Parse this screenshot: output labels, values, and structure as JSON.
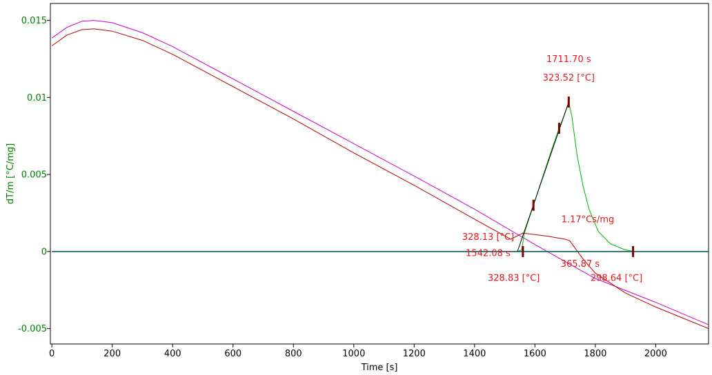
{
  "chart_data": {
    "type": "line",
    "xlabel": "Time [s]",
    "ylabel": "dT/m  [°C/mg]",
    "xlim": [
      -5,
      2175
    ],
    "ylim": [
      -0.006,
      0.0161
    ],
    "x_ticks": [
      0,
      200,
      400,
      600,
      800,
      1000,
      1200,
      1400,
      1600,
      1800,
      2000
    ],
    "y_ticks": [
      -0.005,
      0,
      0.005,
      0.01,
      0.015
    ],
    "y_tick_labels": [
      "-0.005",
      "0",
      "0.005",
      "0.01",
      "0.015"
    ],
    "grid": false,
    "colors": {
      "axis_text": "#008000",
      "annotation": "#e8141c",
      "magenta": "#cc00cc",
      "dark_red": "#b30000",
      "green": "#00b000",
      "baseline": "#0b5c5c",
      "tangent": "#000000",
      "marker": "#7a0000"
    },
    "series": [
      {
        "color": "magenta",
        "x": [
          0,
          50,
          100,
          140,
          200,
          300,
          400,
          600,
          800,
          1000,
          1200,
          1400,
          1600,
          1800,
          2000,
          2175
        ],
        "y": [
          0.01385,
          0.01455,
          0.01495,
          0.015,
          0.01485,
          0.0142,
          0.0133,
          0.0112,
          0.0091,
          0.007,
          0.0049,
          0.00275,
          0.00045,
          -0.00175,
          -0.0033,
          -0.00475
        ]
      },
      {
        "color": "dark_red",
        "x": [
          0,
          50,
          100,
          140,
          200,
          300,
          400,
          600,
          800,
          1000,
          1200,
          1400,
          1520,
          1560,
          1640,
          1700,
          1715,
          1760,
          1800,
          1900,
          2000,
          2175
        ],
        "y": [
          0.01335,
          0.01405,
          0.0144,
          0.01445,
          0.0143,
          0.0137,
          0.0128,
          0.0107,
          0.0086,
          0.0064,
          0.0043,
          0.0021,
          0.0008,
          0.0012,
          0.001,
          0.0008,
          0.0007,
          -0.0005,
          -0.0014,
          -0.0027,
          -0.0036,
          -0.005
        ]
      },
      {
        "color": "green",
        "x": [
          1542,
          1556,
          1565,
          1575,
          1595,
          1620,
          1650,
          1680,
          1700,
          1711.7,
          1722,
          1740,
          1760,
          1780,
          1810,
          1850,
          1900,
          1930
        ],
        "y": [
          0,
          0.0001,
          0.0012,
          0.0018,
          0.003,
          0.0045,
          0.0063,
          0.008,
          0.009,
          0.0097,
          0.0088,
          0.0062,
          0.0042,
          0.0027,
          0.0013,
          0.0005,
          0.0001,
          0
        ]
      },
      {
        "color": "baseline",
        "x": [
          0,
          2175
        ],
        "y": [
          0,
          0
        ]
      },
      {
        "color": "tangent",
        "x": [
          1542,
          1711.7
        ],
        "y": [
          0,
          0.0097
        ]
      }
    ],
    "markers": [
      {
        "x": 1560,
        "y": 0
      },
      {
        "x": 1595,
        "y": 0.003
      },
      {
        "x": 1680,
        "y": 0.008
      },
      {
        "x": 1711.7,
        "y": 0.0097
      },
      {
        "x": 1925,
        "y": 0
      }
    ],
    "annotations": [
      {
        "text": "1711.70 s",
        "x": 1711.7,
        "y": 0.0123
      },
      {
        "text": "323.52 [°C]",
        "x": 1711.7,
        "y": 0.0111
      },
      {
        "text": "1.17°Cs/mg",
        "x": 1775,
        "y": 0.0019
      },
      {
        "text": "328.13 [°C]",
        "x": 1445,
        "y": 0.00075
      },
      {
        "text": "1542.08 s",
        "x": 1445,
        "y": -0.0003
      },
      {
        "text": "328.83 [°C]",
        "x": 1530,
        "y": -0.0019
      },
      {
        "text": "365.87 s",
        "x": 1750,
        "y": -0.001
      },
      {
        "text": "298.64 [°C]",
        "x": 1870,
        "y": -0.0019
      }
    ]
  }
}
